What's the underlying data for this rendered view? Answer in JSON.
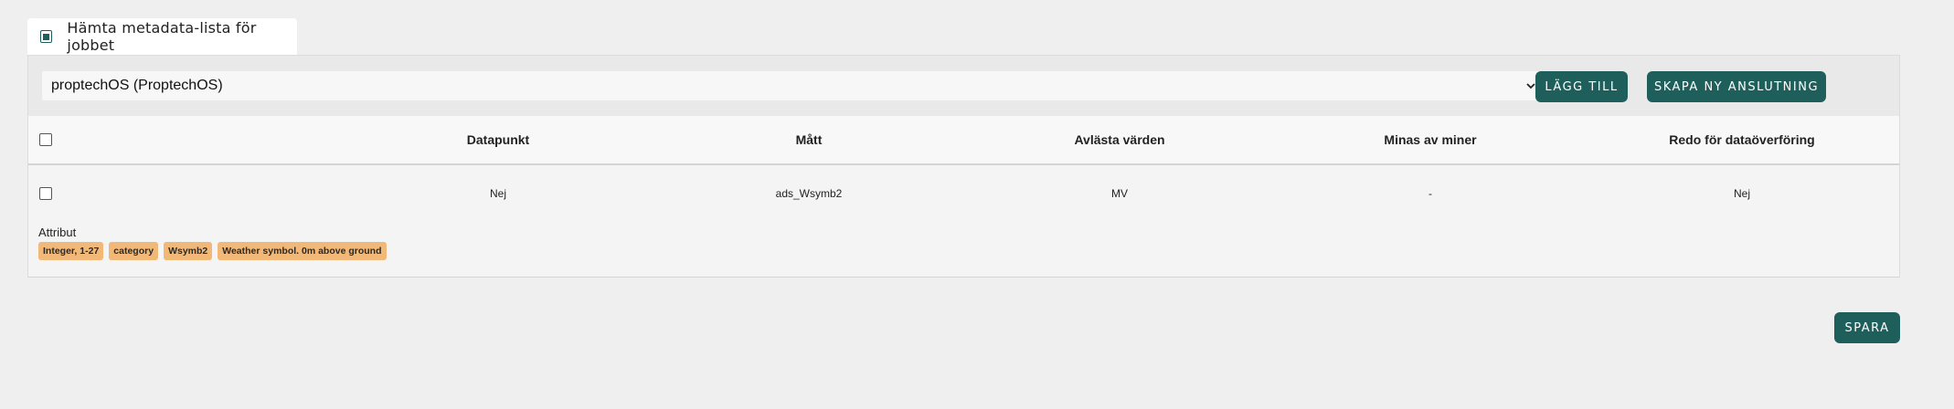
{
  "tab": {
    "checked": true,
    "label": "Hämta metadata-lista för jobbet"
  },
  "connection": {
    "selected": "proptechOS (ProptechOS)",
    "add_label": "LÄGG TILL",
    "create_label": "SKAPA NY ANSLUTNING"
  },
  "table": {
    "columns": [
      "Datapunkt",
      "Mått",
      "Avlästa värden",
      "Minas av miner",
      "Redo för dataöverföring"
    ],
    "rows": [
      {
        "checked": false,
        "cells": [
          "Nej",
          "ads_Wsymb2",
          "MV",
          "-",
          "Nej"
        ],
        "attributes_label": "Attribut",
        "attributes": [
          "Integer, 1-27",
          "category",
          "Wsymb2",
          "Weather symbol. 0m above ground"
        ]
      }
    ]
  },
  "save_label": "SPARA",
  "colors": {
    "primary": "#1f5f5b",
    "chip": "#f1b878",
    "background": "#efefef"
  },
  "icons": {
    "select_caret": "chevron-down-icon"
  }
}
